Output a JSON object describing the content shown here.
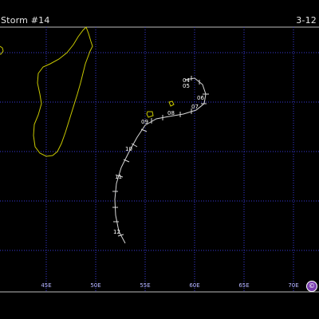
{
  "header": {
    "title": "Storm #14",
    "dates": "3-12"
  },
  "map": {
    "longitude_labels": [
      "45E",
      "50E",
      "55E",
      "60E",
      "65E",
      "70E"
    ],
    "colors": {
      "background": "#000000",
      "grid": "#3a3ad8",
      "land_outline": "#c8c800",
      "track": "#d8d8d8",
      "frame": "#bbbbbb"
    }
  },
  "track": {
    "day_labels": [
      "04",
      "05",
      "06",
      "07",
      "08",
      "09",
      "10",
      "11",
      "12"
    ]
  },
  "copyright_icon": "©"
}
